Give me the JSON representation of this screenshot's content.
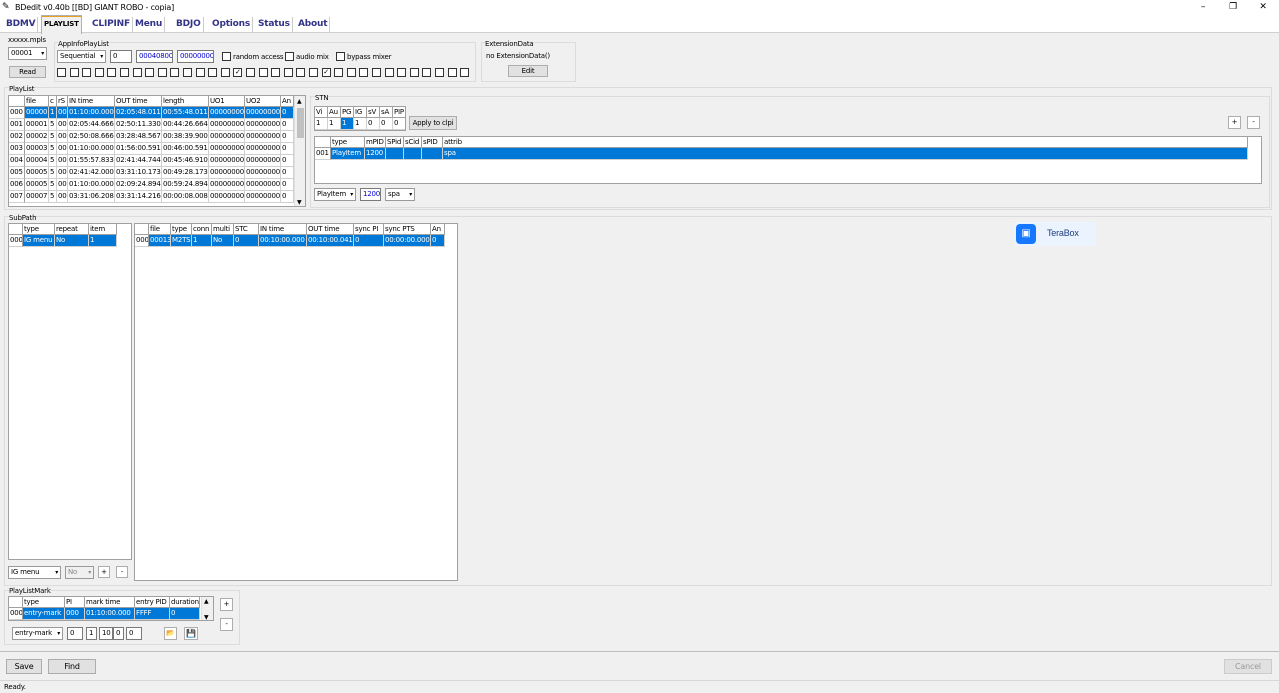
{
  "window": {
    "title": "BDedit v0.40b [[BD] GIANT ROBO - copia]",
    "min": "–",
    "max": "❐",
    "close": "✕"
  },
  "tabs": [
    "BDMV",
    "PLAYLIST",
    "CLIPINF",
    "Menu",
    "BDJO",
    "Options",
    "Status",
    "About"
  ],
  "mpls": {
    "label": "xxxxx.mpls",
    "select": "00001",
    "read": "Read"
  },
  "app_info": {
    "label": "AppInfoPlayList",
    "mode": "Sequential",
    "v1": "0",
    "v2": "00040800",
    "v3": "00000000",
    "random_access": "random access",
    "audio_mix": "audio mix",
    "bypass_mixer": "bypass mixer"
  },
  "uo_checked": [
    14,
    21
  ],
  "ext": {
    "label": "ExtensionData",
    "value": "no ExtensionData()",
    "edit": "Edit"
  },
  "playlist": {
    "label": "PlayList",
    "headers": [
      "",
      "file",
      "c",
      "rS",
      "IN time",
      "OUT time",
      "length",
      "UO1",
      "UO2",
      "An"
    ],
    "rows": [
      [
        "000",
        "00000",
        "1",
        "00",
        "01:10:00.000",
        "02:05:48.011",
        "00:55:48.011",
        "00000000",
        "00000000",
        "0"
      ],
      [
        "001",
        "00001",
        "5",
        "00",
        "02:05:44.666",
        "02:50:11.330",
        "00:44:26.664",
        "00000000",
        "00000000",
        "0"
      ],
      [
        "002",
        "00002",
        "5",
        "00",
        "02:50:08.666",
        "03:28:48.567",
        "00:38:39.900",
        "00000000",
        "00000000",
        "0"
      ],
      [
        "003",
        "00003",
        "5",
        "00",
        "01:10:00.000",
        "01:56:00.591",
        "00:46:00.591",
        "00000000",
        "00000000",
        "0"
      ],
      [
        "004",
        "00004",
        "5",
        "00",
        "01:55:57.833",
        "02:41:44.744",
        "00:45:46.910",
        "00000000",
        "00000000",
        "0"
      ],
      [
        "005",
        "00005",
        "5",
        "00",
        "02:41:42.000",
        "03:31:10.173",
        "00:49:28.173",
        "00000000",
        "00000000",
        "0"
      ],
      [
        "006",
        "00005",
        "5",
        "00",
        "01:10:00.000",
        "02:09:24.894",
        "00:59:24.894",
        "00000000",
        "00000000",
        "0"
      ],
      [
        "007",
        "00007",
        "5",
        "00",
        "03:31:06.208",
        "03:31:14.216",
        "00:00:08.008",
        "00000000",
        "00000000",
        "0"
      ]
    ]
  },
  "stn": {
    "label": "STN",
    "headers": [
      "Vi",
      "Au",
      "PG",
      "IG",
      "sV",
      "sA",
      "PIP"
    ],
    "values": [
      "1",
      "1",
      "1",
      "1",
      "0",
      "0",
      "0"
    ],
    "apply": "Apply to clpi",
    "table_headers": [
      "",
      "type",
      "mPID",
      "SPid",
      "sCid",
      "sPID",
      "attrib"
    ],
    "row": [
      "001",
      "PlayItem",
      "1200",
      "",
      "",
      "",
      "spa"
    ],
    "sel1": "PlayItem",
    "input": "1200",
    "sel2": "spa",
    "plus": "+",
    "minus": "-"
  },
  "subpath": {
    "label": "SubPath",
    "headers": [
      "",
      "type",
      "repeat",
      "item"
    ],
    "row": [
      "000",
      "IG menu",
      "No",
      "1"
    ],
    "headers2": [
      "",
      "file",
      "type",
      "conn",
      "multi",
      "STC",
      "IN time",
      "OUT time",
      "sync PI",
      "sync PTS",
      "An"
    ],
    "row2": [
      "000",
      "00013",
      "M2TS",
      "1",
      "No",
      "0",
      "00:10:00.000",
      "00:10:00.041",
      "0",
      "00:00:00.000",
      "0"
    ],
    "sel1": "IG menu",
    "sel2": "No",
    "plus": "+",
    "minus": "-"
  },
  "plmark": {
    "label": "PlayListMark",
    "headers": [
      "",
      "type",
      "PI",
      "mark time",
      "entry PID",
      "duration"
    ],
    "row": [
      "000",
      "entry-mark",
      "000",
      "01:10:00.000",
      "FFFF",
      "0"
    ],
    "sel": "entry-mark",
    "f1": "0",
    "f2": "1",
    "f3": "10",
    "f4": "0",
    "f5": "0",
    "plus": "+",
    "minus": "-"
  },
  "terabox": "TeraBox",
  "footer": {
    "save": "Save",
    "find": "Find",
    "cancel": "Cancel",
    "status": "Ready."
  }
}
